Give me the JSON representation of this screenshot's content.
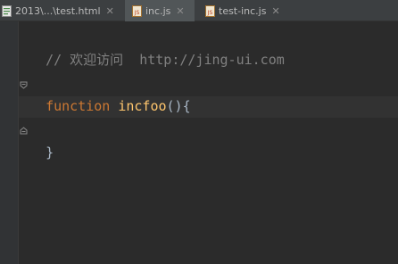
{
  "tabs": [
    {
      "label": "2013\\...\\test.html",
      "type": "html",
      "active": false
    },
    {
      "label": "inc.js",
      "type": "js",
      "active": true
    },
    {
      "label": "test-inc.js",
      "type": "js",
      "active": false
    }
  ],
  "editor": {
    "comment": "// 欢迎访问  http://jing-ui.com",
    "keyword": "function",
    "function_name": "incfoo",
    "signature_rest": "(){",
    "closing_brace": "}"
  },
  "colors": {
    "background": "#2b2b2b",
    "keyword": "#cc7832",
    "function_name": "#ffc66d",
    "comment": "#808080"
  }
}
